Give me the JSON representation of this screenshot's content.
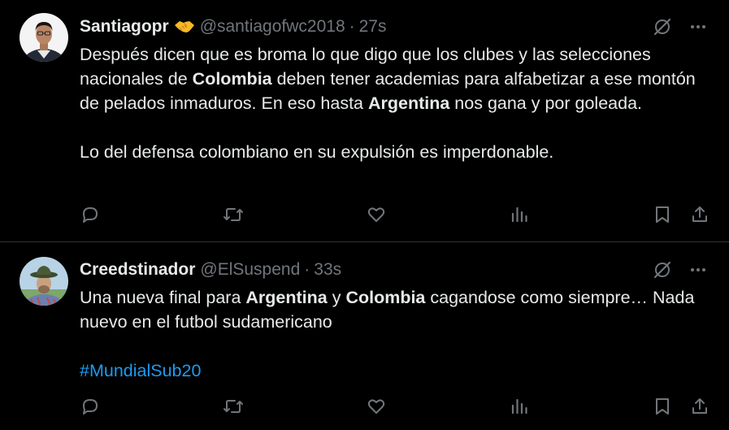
{
  "tweets": [
    {
      "display_name": "Santiagopr",
      "badge_icon": "handshake-icon",
      "handle": "@santiagofwc2018",
      "separator": "·",
      "time": "27s",
      "paragraphs": [
        [
          {
            "text": "Después dicen que es broma lo que digo que los clubes y las selecciones nacionales de ",
            "bold": false
          },
          {
            "text": "Colombia",
            "bold": true
          },
          {
            "text": " deben tener academias para alfabetizar a ese montón de pelados inmaduros. En eso hasta ",
            "bold": false
          },
          {
            "text": "Argentina",
            "bold": true
          },
          {
            "text": " nos gana y por goleada.",
            "bold": false
          }
        ],
        [
          {
            "text": "Lo del defensa colombiano en su expulsión es imperdonable.",
            "bold": false
          }
        ]
      ]
    },
    {
      "display_name": "Creedstinador",
      "handle": "@ElSuspend",
      "separator": "·",
      "time": "33s",
      "paragraphs": [
        [
          {
            "text": "Una nueva final para ",
            "bold": false
          },
          {
            "text": "Argentina",
            "bold": true
          },
          {
            "text": " y ",
            "bold": false
          },
          {
            "text": "Colombia",
            "bold": true
          },
          {
            "text": " cagandose como siempre… Nada nuevo en el futbol sudamericano",
            "bold": false
          }
        ],
        [
          {
            "text": "#MundialSub20",
            "bold": false,
            "hashtag": true
          }
        ]
      ]
    }
  ],
  "colors": {
    "background": "#000000",
    "text": "#e7e9ea",
    "secondary": "#71767b",
    "link": "#1d9bf0",
    "divider": "#2f3336"
  },
  "icons": {
    "reply": "reply-icon",
    "retweet": "retweet-icon",
    "like": "heart-icon",
    "views": "views-icon",
    "bookmark": "bookmark-icon",
    "share": "share-icon",
    "grok": "grok-icon",
    "more": "more-icon"
  }
}
